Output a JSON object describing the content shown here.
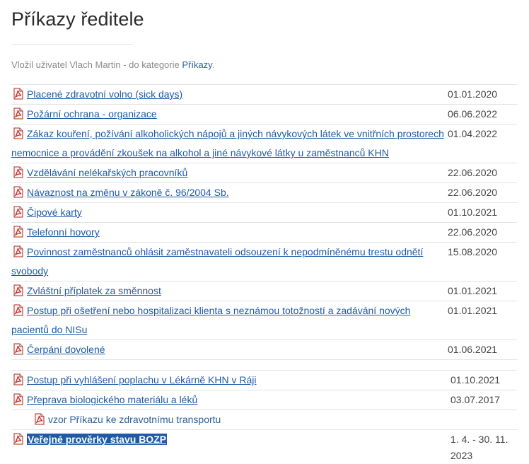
{
  "page": {
    "title": "Příkazy ředitele",
    "meta_prefix": "Vložil uživatel Vlach Martin - do kategorie ",
    "meta_category": "Příkazy",
    "meta_suffix": "."
  },
  "items": [
    {
      "label": "Placené zdravotní volno (sick days)",
      "date": "01.01.2020"
    },
    {
      "label": "Požární ochrana - organizace",
      "date": "06.06.2022"
    },
    {
      "label": "Zákaz kouření, požívání alkoholických nápojů a jiných návykových látek ve vnitřních prostorech nemocnice a provádění zkoušek na alkohol a jiné návykové látky u zaměstnanců KHN",
      "date": "01.04.2022"
    },
    {
      "label": "Vzdělávání nelékařských pracovníků",
      "date": "22.06.2020"
    },
    {
      "label": "Návaznost na změnu v zákoně č. 96/2004 Sb.",
      "date": "22.06.2020"
    },
    {
      "label": "Čipové karty",
      "date": "01.10.2021"
    },
    {
      "label": "Telefonní hovory",
      "date": "22.06.2020"
    },
    {
      "label": "Povinnost zaměstnanců ohlásit zaměstnavateli odsouzení k nepodmíněnému trestu odnětí svobody",
      "date": "15.08.2020"
    },
    {
      "label": "Zvláštní příplatek za směnnost",
      "date": "01.01.2021"
    },
    {
      "label": "Postup při ošetření nebo hospitalizaci klienta s neznámou totožností a zadávání nových pacientů do NISu",
      "date": "01.01.2021"
    },
    {
      "label": "Čerpání dovolené",
      "date": "01.06.2021"
    },
    {
      "label": "Postup při vyhlášení poplachu v Lékárně KHN v Ráji",
      "date": "01.10.2021"
    },
    {
      "label": "Přeprava biologického materiálu a léků",
      "date": "03.07.2017"
    },
    {
      "label": "vzor Příkazu ke zdravotnímu transportu",
      "date": ""
    },
    {
      "label": "Veřejné prověrky stavu BOZP",
      "date": "1. 4. - 30. 11. 2023"
    }
  ]
}
